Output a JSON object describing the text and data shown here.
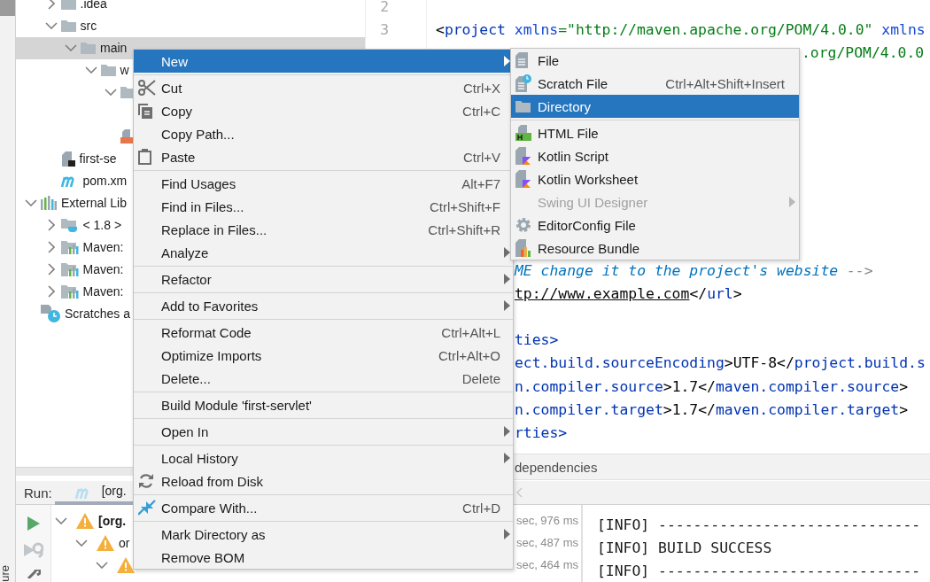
{
  "side_strip": {
    "label": "ure"
  },
  "project": {
    "tree": [
      {
        "children": [
          {
            "label": ".idea",
            "kind": "folder",
            "expanded": false,
            "selected": false
          },
          {
            "label": "src",
            "kind": "folder",
            "expanded": true,
            "selected": false,
            "children": [
              {
                "label": "main",
                "kind": "folder",
                "expanded": true,
                "selected": true,
                "children": [
                  {
                    "label": "w",
                    "kind": "folder",
                    "expanded": true,
                    "selected": false,
                    "children": [
                      {
                        "kind": "folder",
                        "expanded": true,
                        "selected": false
                      },
                      {
                        "kind": "jsp",
                        "selected": false
                      }
                    ]
                  }
                ]
              }
            ]
          },
          {
            "label": "first-se",
            "kind": "module",
            "selected": false
          },
          {
            "label": "pom.xm",
            "kind": "maven",
            "selected": false
          }
        ]
      },
      {
        "label": "External Lib",
        "kind": "library",
        "expanded": true,
        "selected": false,
        "children": [
          {
            "label": "< 1.8 >",
            "kind": "jdk-folder",
            "expanded": false,
            "selected": false
          },
          {
            "label": "Maven:",
            "kind": "maven-lib",
            "expanded": false,
            "selected": false
          },
          {
            "label": "Maven:",
            "kind": "maven-lib",
            "expanded": false,
            "selected": false
          },
          {
            "label": "Maven:",
            "kind": "maven-lib",
            "expanded": false,
            "selected": false
          }
        ]
      },
      {
        "label": "Scratches a",
        "kind": "scratches",
        "selected": false
      }
    ]
  },
  "editor": {
    "top_lines": [
      {
        "number": "2"
      },
      {
        "number": "3",
        "segments": [
          {
            "text": "<",
            "kind": "text"
          },
          {
            "text": "project",
            "kind": "tag"
          },
          {
            "text": " xmlns",
            "kind": "attr"
          },
          {
            "text": "=\"http://maven.apache.org/POM/4.0.0\"",
            "kind": "str"
          },
          {
            "text": " xmlns",
            "kind": "attr"
          }
        ]
      },
      {
        "kind": "after-submenu",
        "segments": [
          {
            "text": ".org/POM/4.0.0",
            "kind": "str"
          }
        ]
      }
    ],
    "lower_blocks": [
      [
        {
          "segments": [
            {
              "text": "ME change it to the project's website",
              "kind": "comment"
            },
            {
              "text": " -->",
              "kind": "comment-end"
            }
          ]
        },
        {
          "segments": [
            {
              "text": "tp://www.example.com",
              "kind": "link"
            },
            {
              "text": "</",
              "kind": "text"
            },
            {
              "text": "url",
              "kind": "tag"
            },
            {
              "text": ">",
              "kind": "text"
            }
          ]
        }
      ],
      [
        {
          "segments": [
            {
              "text": "ties>",
              "kind": "tag"
            }
          ]
        },
        {
          "segments": [
            {
              "text": "ect.build.sourceEncoding",
              "kind": "tag"
            },
            {
              "text": ">UTF-8</",
              "kind": "text"
            },
            {
              "text": "project.build.s",
              "kind": "tag"
            }
          ]
        },
        {
          "segments": [
            {
              "text": "n.compiler.source",
              "kind": "tag"
            },
            {
              "text": ">1.7</",
              "kind": "text"
            },
            {
              "text": "maven.compiler.source",
              "kind": "tag"
            },
            {
              "text": ">",
              "kind": "text"
            }
          ]
        },
        {
          "segments": [
            {
              "text": "n.compiler.target",
              "kind": "tag"
            },
            {
              "text": ">1.7</",
              "kind": "text"
            },
            {
              "text": "maven.compiler.target",
              "kind": "tag"
            },
            {
              "text": ">",
              "kind": "text"
            }
          ]
        },
        {
          "segments": [
            {
              "text": "rties>",
              "kind": "tag"
            }
          ]
        }
      ]
    ],
    "breadcrumb": "dependencies"
  },
  "run": {
    "title": "Run:",
    "tab": "[org.",
    "tree": [
      {
        "label": "[org.",
        "expanded": true,
        "time": "sec, 976 ms",
        "children": [
          {
            "label": "or",
            "expanded": true,
            "time": "sec, 487 ms",
            "children": [
              {
                "expanded": true,
                "time": "sec, 464 ms"
              }
            ]
          }
        ]
      }
    ],
    "console": [
      "[INFO] ------------------------------",
      "[INFO] BUILD SUCCESS",
      "[INFO] ------------------------------"
    ]
  },
  "context_menu": {
    "groups": [
      {
        "items": [
          {
            "label": "New",
            "submenu": true,
            "selected": true,
            "disabled": false
          }
        ]
      },
      {
        "items": [
          {
            "label": "Cut",
            "shortcut": "Ctrl+X",
            "kind": "scissors",
            "submenu": false,
            "selected": false,
            "disabled": false
          },
          {
            "label": "Copy",
            "shortcut": "Ctrl+C",
            "kind": "copy",
            "submenu": false,
            "selected": false,
            "disabled": false
          },
          {
            "label": "Copy Path...",
            "submenu": false,
            "selected": false,
            "disabled": false
          },
          {
            "label": "Paste",
            "shortcut": "Ctrl+V",
            "kind": "paste",
            "submenu": false,
            "selected": false,
            "disabled": false
          }
        ]
      },
      {
        "items": [
          {
            "label": "Find Usages",
            "shortcut": "Alt+F7",
            "submenu": false,
            "selected": false,
            "disabled": false
          },
          {
            "label": "Find in Files...",
            "shortcut": "Ctrl+Shift+F",
            "submenu": false,
            "selected": false,
            "disabled": false
          },
          {
            "label": "Replace in Files...",
            "shortcut": "Ctrl+Shift+R",
            "submenu": false,
            "selected": false,
            "disabled": false
          },
          {
            "label": "Analyze",
            "submenu": true,
            "selected": false,
            "disabled": false
          }
        ]
      },
      {
        "items": [
          {
            "label": "Refactor",
            "submenu": true,
            "selected": false,
            "disabled": false
          }
        ]
      },
      {
        "items": [
          {
            "label": "Add to Favorites",
            "submenu": true,
            "selected": false,
            "disabled": false
          }
        ]
      },
      {
        "items": [
          {
            "label": "Reformat Code",
            "shortcut": "Ctrl+Alt+L",
            "submenu": false,
            "selected": false,
            "disabled": false
          },
          {
            "label": "Optimize Imports",
            "shortcut": "Ctrl+Alt+O",
            "submenu": false,
            "selected": false,
            "disabled": false
          },
          {
            "label": "Delete...",
            "shortcut": "Delete",
            "submenu": false,
            "selected": false,
            "disabled": false
          }
        ]
      },
      {
        "items": [
          {
            "label": "Build Module 'first-servlet'",
            "submenu": false,
            "selected": false,
            "disabled": false
          }
        ]
      },
      {
        "items": [
          {
            "label": "Open In",
            "submenu": true,
            "selected": false,
            "disabled": false
          }
        ]
      },
      {
        "items": [
          {
            "label": "Local History",
            "submenu": true,
            "selected": false,
            "disabled": false
          },
          {
            "label": "Reload from Disk",
            "kind": "reload",
            "submenu": false,
            "selected": false,
            "disabled": false
          }
        ]
      },
      {
        "items": [
          {
            "label": "Compare With...",
            "shortcut": "Ctrl+D",
            "kind": "compare",
            "submenu": false,
            "selected": false,
            "disabled": false
          }
        ]
      },
      {
        "items": [
          {
            "label": "Mark Directory as",
            "submenu": true,
            "selected": false,
            "disabled": false
          },
          {
            "label": "Remove BOM",
            "submenu": false,
            "selected": false,
            "disabled": false
          }
        ]
      }
    ]
  },
  "new_submenu": {
    "groups": [
      {
        "items": [
          {
            "label": "File",
            "kind": "file",
            "submenu": false,
            "selected": false,
            "disabled": false
          },
          {
            "label": "Scratch File",
            "shortcut": "Ctrl+Alt+Shift+Insert",
            "kind": "scratch",
            "submenu": false,
            "selected": false,
            "disabled": false
          },
          {
            "label": "Directory",
            "kind": "folder",
            "submenu": false,
            "selected": true,
            "disabled": false
          }
        ]
      },
      {
        "items": [
          {
            "label": "HTML File",
            "kind": "html",
            "submenu": false,
            "selected": false,
            "disabled": false
          },
          {
            "label": "Kotlin Script",
            "kind": "kotlin",
            "submenu": false,
            "selected": false,
            "disabled": false
          },
          {
            "label": "Kotlin Worksheet",
            "kind": "kotlin",
            "submenu": false,
            "selected": false,
            "disabled": false
          },
          {
            "label": "Swing UI Designer",
            "submenu": true,
            "selected": false,
            "disabled": true
          },
          {
            "label": "EditorConfig File",
            "kind": "gear",
            "submenu": false,
            "selected": false,
            "disabled": false
          },
          {
            "label": "Resource Bundle",
            "kind": "bundle",
            "submenu": false,
            "selected": false,
            "disabled": false
          }
        ]
      }
    ]
  }
}
